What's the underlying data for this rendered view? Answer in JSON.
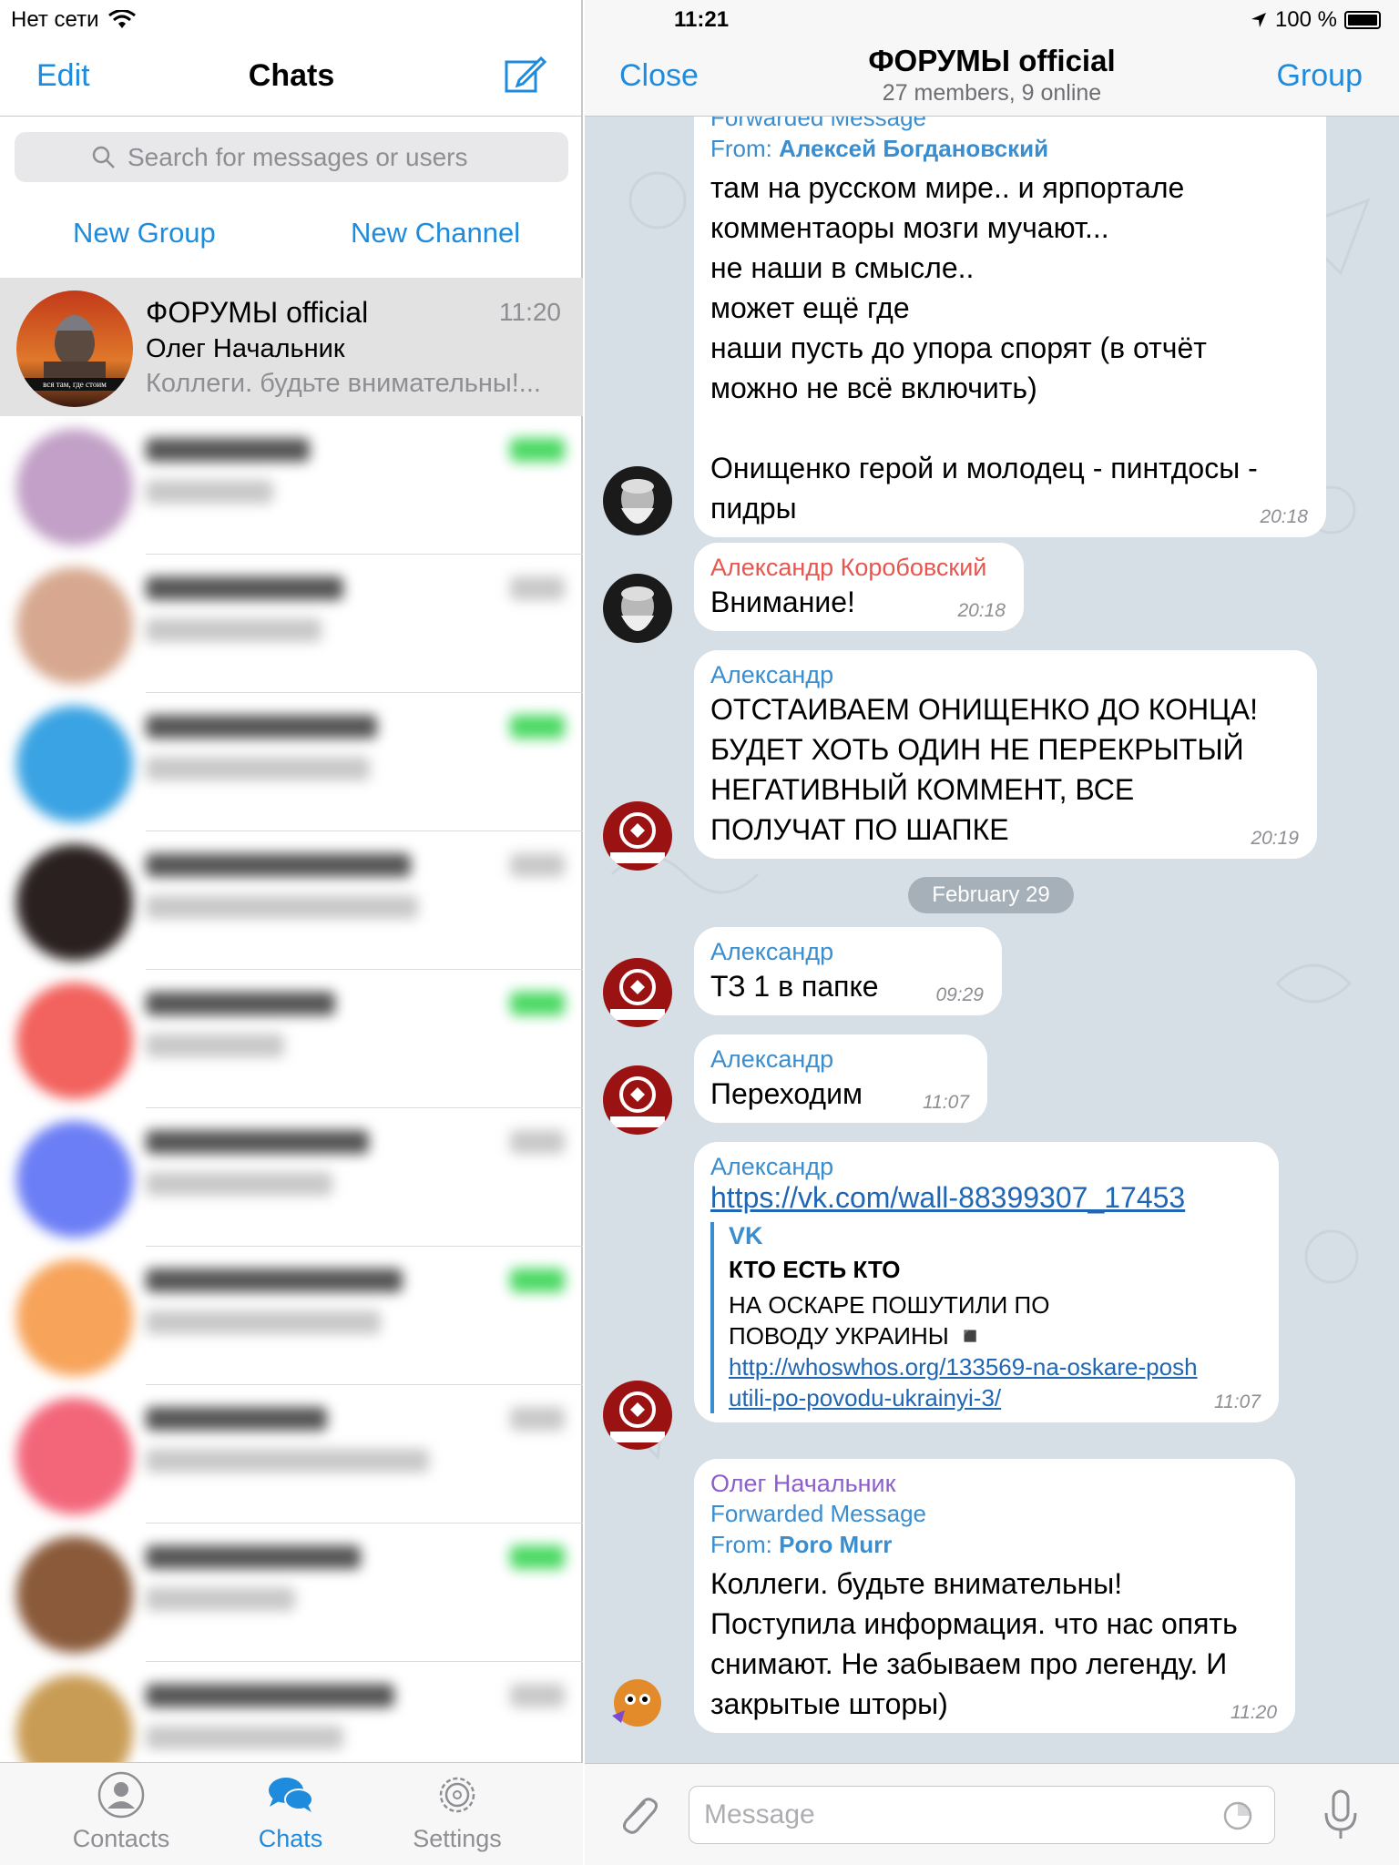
{
  "status_bar": {
    "carrier": "Нет сети",
    "time": "11:21",
    "battery": "100 %"
  },
  "left_nav": {
    "edit_label": "Edit",
    "title": "Chats"
  },
  "search": {
    "placeholder": "Search for messages or users"
  },
  "quick_actions": {
    "new_group": "New Group",
    "new_channel": "New Channel"
  },
  "active_chat_item": {
    "name": "ФОРУМЫ official",
    "time": "11:20",
    "sender": "Олег Начальник",
    "preview": "Коллеги. будьте внимательны!...",
    "avatar_caption": "вся там, где стоим"
  },
  "blurred_chats": [
    {
      "avatar_color": "#c2a0c7"
    },
    {
      "avatar_color": "#d7a88f"
    },
    {
      "avatar_color": "#3aa3e3"
    },
    {
      "avatar_color": "#2a2020"
    },
    {
      "avatar_color": "#f2625e"
    },
    {
      "avatar_color": "#6c7ef5"
    },
    {
      "avatar_color": "#f7a35a"
    },
    {
      "avatar_color": "#f3667a"
    },
    {
      "avatar_color": "#8a5a3a"
    },
    {
      "avatar_color": "#c99c55"
    }
  ],
  "tabbar": {
    "contacts": "Contacts",
    "chats": "Chats",
    "settings": "Settings"
  },
  "right_nav": {
    "close_label": "Close",
    "title": "ФОРУМЫ official",
    "subtitle": "27 members, 9 online",
    "group_label": "Group"
  },
  "messages": {
    "m1": {
      "forward_header": "Forwarded Message",
      "from_prefix": "From: ",
      "from_name": "Алексей Богдановский",
      "text": "там на русском мире.. и ярпортале\nкомментаоры мозги мучают...\nне наши в смысле..\nможет ещё где\nнаши пусть до упора спорят (в отчёт\nможно не всё включить)\n\nОнищенко герой и молодец - пинтдосы -\nпидры",
      "time": "20:18"
    },
    "m2": {
      "sender": "Александр Коробовский",
      "text": "Внимание!",
      "time": "20:18"
    },
    "m3": {
      "sender": "Александр",
      "text": "ОТСТАИВАЕМ ОНИЩЕНКО ДО КОНЦА!\nБУДЕТ ХОТЬ ОДИН НЕ ПЕРЕКРЫТЫЙ\nНЕГАТИВНЫЙ КОММЕНТ, ВСЕ\nПОЛУЧАТ ПО ШАПКЕ",
      "time": "20:19"
    },
    "date_separator": "February 29",
    "m4": {
      "sender": "Александр",
      "text": "ТЗ 1 в папке",
      "time": "09:29"
    },
    "m5": {
      "sender": "Александр",
      "text": "Переходим",
      "time": "11:07"
    },
    "m6": {
      "sender": "Александр",
      "link": "https://vk.com/wall-88399307_17453",
      "preview_site": "VK",
      "preview_title": "КТО ЕСТЬ КТО",
      "preview_desc": "НА ОСКАРЕ ПОШУТИЛИ ПО\nПОВОДУ УКРАИНЫ ◾",
      "preview_link_1": "http://whoswhos.org/133569-na-oskare-posh",
      "preview_link_2": "utili-po-povodu-ukrainyi-3/",
      "time": "11:07"
    },
    "m7": {
      "sender": "Олег Начальник",
      "forward_header": "Forwarded Message",
      "from_prefix": "From: ",
      "from_name": "Poro Murr",
      "text": "Коллеги. будьте внимательны!\nПоступила информация. что нас опять\nснимают. Не забываем про легенду. И\nзакрытые шторы)",
      "time": "11:20"
    }
  },
  "composer": {
    "placeholder": "Message"
  },
  "colors": {
    "accent": "#1f8bdc",
    "sender_red": "#e5574f",
    "sender_purple": "#8e5ec9",
    "chat_bg": "#d6dee6"
  }
}
